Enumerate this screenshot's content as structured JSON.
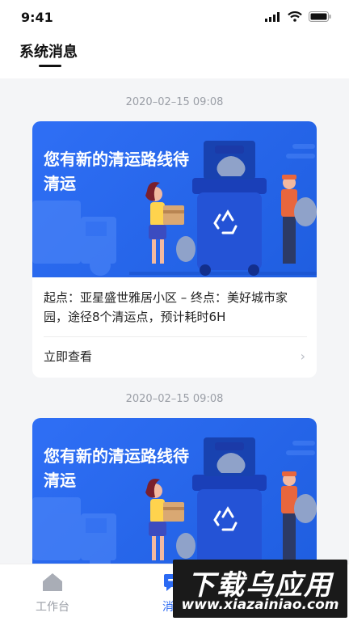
{
  "status_bar": {
    "time": "9:41"
  },
  "header": {
    "title": "系统消息"
  },
  "messages": [
    {
      "timestamp": "2020–02–15 09:08",
      "banner_title": "您有新的清运路线待清运",
      "description": "起点：亚星盛世雅居小区 – 终点：美好城市家园，途径8个清运点，预计耗时6H",
      "action_label": "立即查看"
    },
    {
      "timestamp": "2020–02–15 09:08",
      "banner_title": "您有新的清运路线待清运"
    }
  ],
  "tabbar": {
    "items": [
      {
        "label": "工作台",
        "icon": "home-icon",
        "active": false
      },
      {
        "label": "消息",
        "icon": "message-icon",
        "active": true
      }
    ]
  },
  "watermark": {
    "title": "下载乌应用",
    "url": "www.xiazainiao.com"
  },
  "colors": {
    "accent": "#2b6af3",
    "inactive": "#9a9ea6",
    "banner": "#2f6ff5"
  }
}
